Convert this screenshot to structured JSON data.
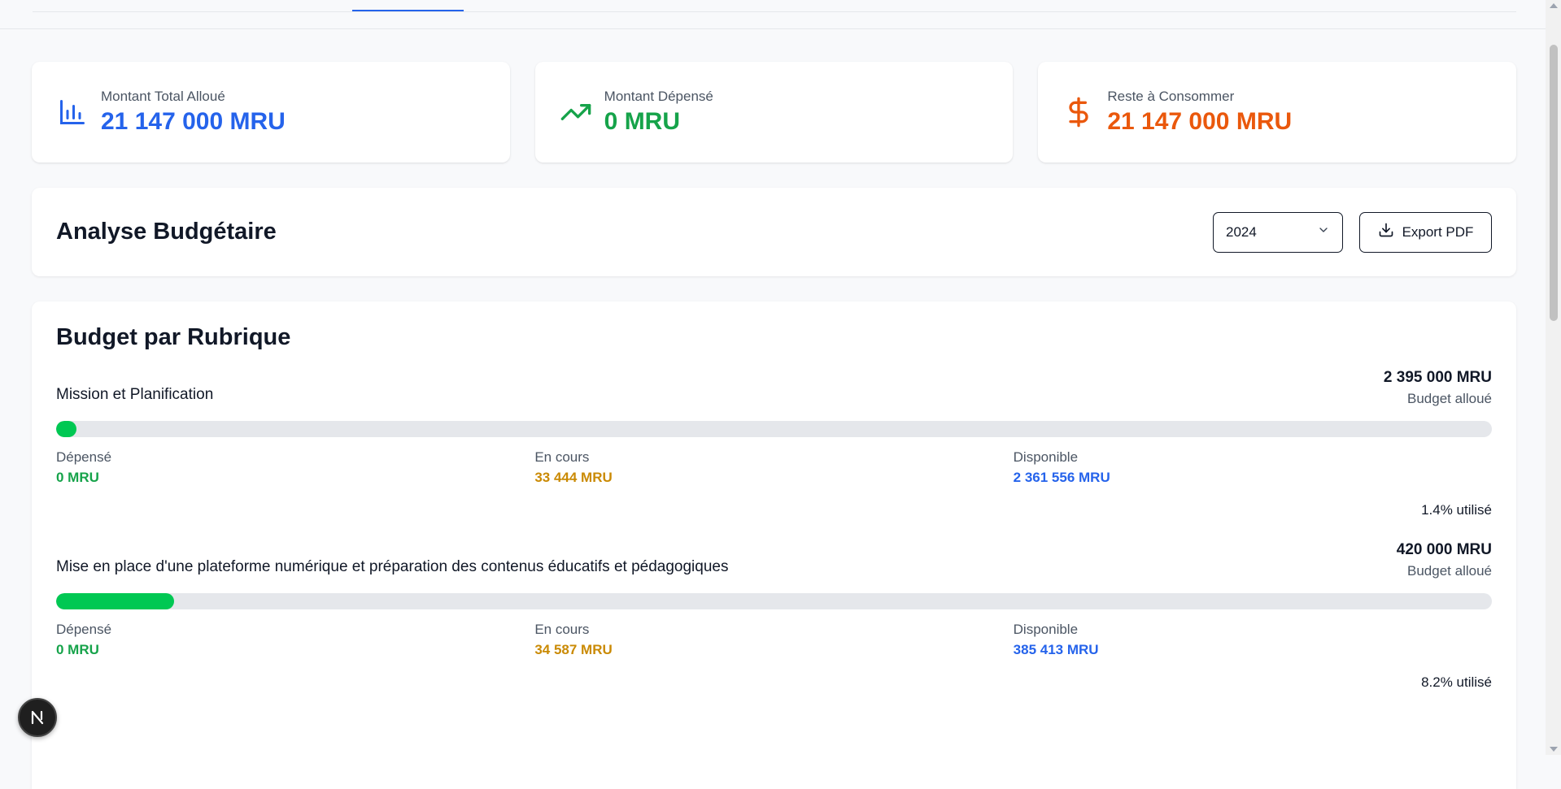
{
  "stats": [
    {
      "label": "Montant Total Alloué",
      "value": "21 147 000 MRU",
      "color": "#2563eb",
      "icon": "bar-chart-icon"
    },
    {
      "label": "Montant Dépensé",
      "value": "0 MRU",
      "color": "#16a34a",
      "icon": "trending-up-icon"
    },
    {
      "label": "Reste à Consommer",
      "value": "21 147 000 MRU",
      "color": "#ea580c",
      "icon": "dollar-icon"
    }
  ],
  "analysis": {
    "title": "Analyse Budgétaire",
    "year": "2024",
    "export_label": "Export PDF"
  },
  "rubriques": {
    "title": "Budget par Rubrique",
    "items": [
      {
        "name": "Mission et Planification",
        "amount": "2 395 000 MRU",
        "amount_label": "Budget alloué",
        "progress": 0.014,
        "depense_label": "Dépensé",
        "depense": "0 MRU",
        "encours_label": "En cours",
        "encours": "33 444 MRU",
        "disponible_label": "Disponible",
        "disponible": "2 361 556 MRU",
        "usage": "1.4% utilisé"
      },
      {
        "name": "Mise en place d'une plateforme numérique et préparation des contenus éducatifs et pédagogiques",
        "amount": "420 000 MRU",
        "amount_label": "Budget alloué",
        "progress": 0.082,
        "depense_label": "Dépensé",
        "depense": "0 MRU",
        "encours_label": "En cours",
        "encours": "34 587 MRU",
        "disponible_label": "Disponible",
        "disponible": "385 413 MRU",
        "usage": "8.2% utilisé"
      }
    ]
  },
  "badge": {
    "label": "N"
  }
}
